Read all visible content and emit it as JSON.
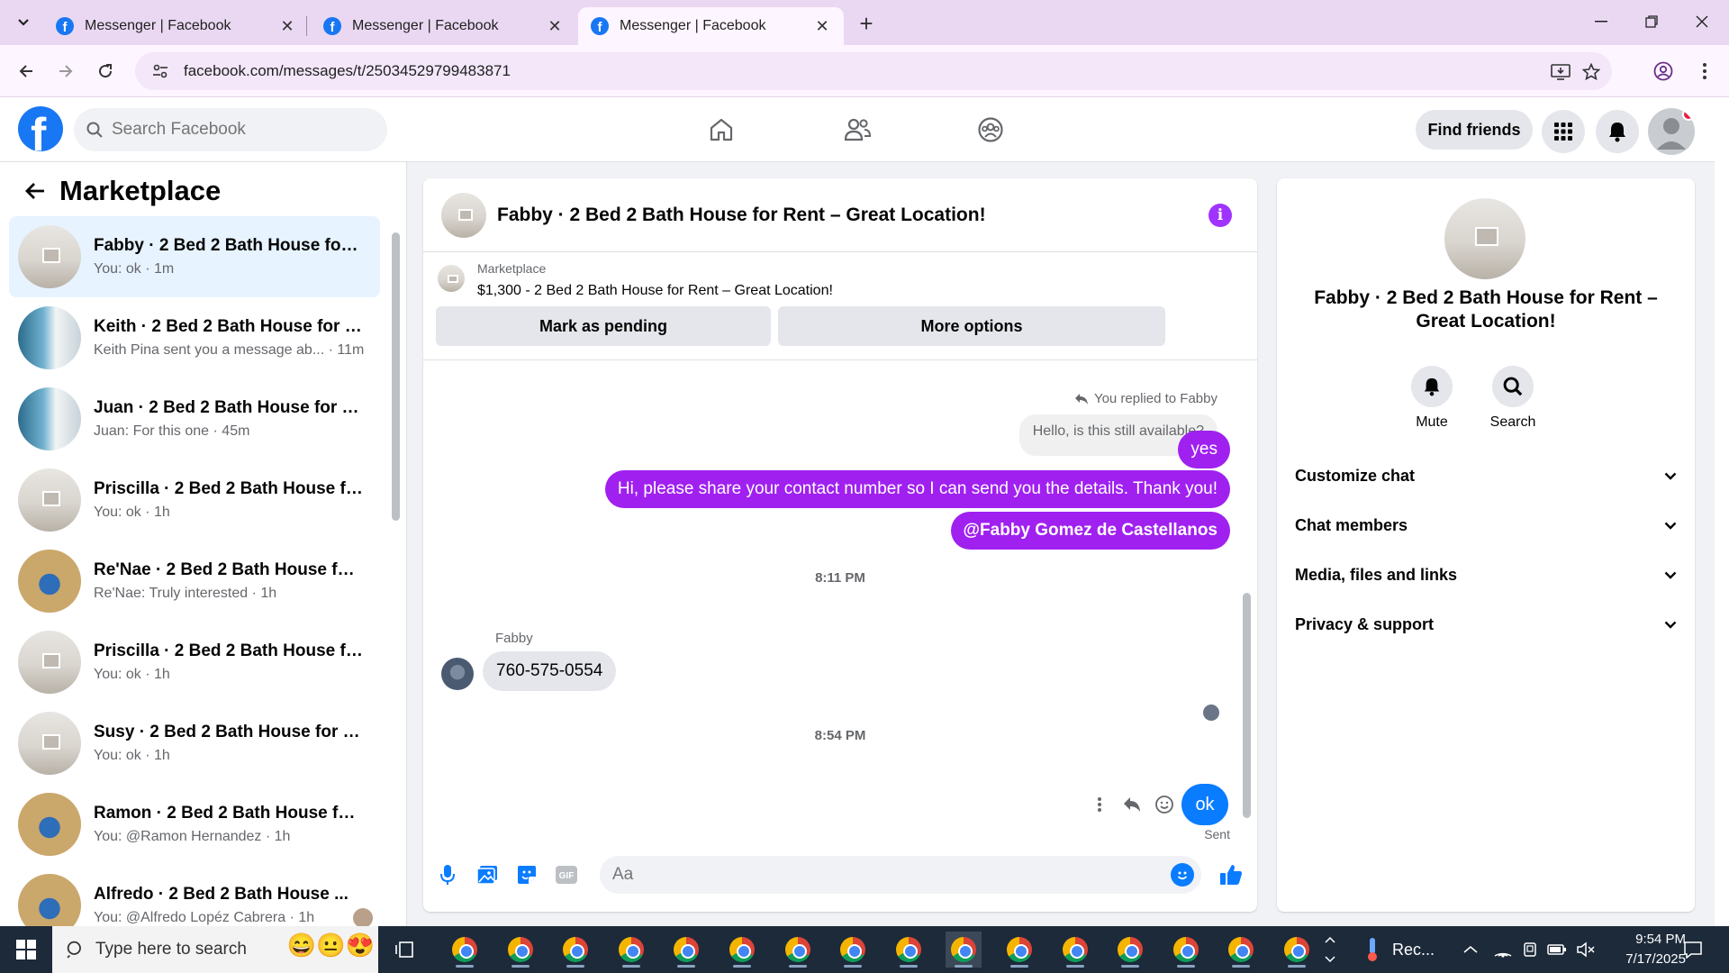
{
  "browser": {
    "tabs": [
      {
        "title": "Messenger | Facebook",
        "active": false
      },
      {
        "title": "Messenger | Facebook",
        "active": false
      },
      {
        "title": "Messenger | Facebook",
        "active": true
      }
    ],
    "url": "facebook.com/messages/t/25034529799483871"
  },
  "fb_header": {
    "search_placeholder": "Search Facebook",
    "find_friends_label": "Find friends"
  },
  "left_panel": {
    "title": "Marketplace",
    "conversations": [
      {
        "name": "Fabby · 2 Bed 2 Bath House for ...",
        "preview": "You: ok",
        "time": "1m",
        "avatar": "room",
        "selected": true
      },
      {
        "name": "Keith · 2 Bed 2 Bath House for R...",
        "preview": "Keith Pina sent you a message ab...",
        "time": "11m",
        "avatar": "blue"
      },
      {
        "name": "Juan · 2 Bed 2 Bath House for R...",
        "preview": "Juan: For this one",
        "time": "45m",
        "avatar": "blue"
      },
      {
        "name": "Priscilla · 2 Bed 2 Bath House for...",
        "preview": "You: ok",
        "time": "1h",
        "avatar": "room"
      },
      {
        "name": "Re'Nae · 2 Bed 2 Bath House for ...",
        "preview": "Re'Nae: Truly interested",
        "time": "1h",
        "avatar": "gold"
      },
      {
        "name": "Priscilla · 2 Bed 2 Bath House for...",
        "preview": "You: ok",
        "time": "1h",
        "avatar": "room"
      },
      {
        "name": "Susy · 2 Bed 2 Bath House for R...",
        "preview": "You: ok",
        "time": "1h",
        "avatar": "room"
      },
      {
        "name": "Ramon · 2 Bed 2 Bath House for...",
        "preview": "You: @Ramon Hernandez",
        "time": "1h",
        "avatar": "gold"
      },
      {
        "name": "Alfredo · 2 Bed 2 Bath House ...",
        "preview": "You: @Alfredo Lopéz Cabrera",
        "time": "1h",
        "avatar": "gold"
      }
    ]
  },
  "chat": {
    "title": "Fabby · 2 Bed 2 Bath House for Rent – Great Location!",
    "info_glyph": "i",
    "marketplace_label": "Marketplace",
    "listing": "$1,300 - 2 Bed 2 Bath House for Rent – Great Location!",
    "mark_pending_label": "Mark as pending",
    "more_options_label": "More options",
    "replied_label": "You replied to Fabby",
    "quoted_text": "Hello, is this still available?",
    "sent_messages": [
      "yes",
      "Hi, please share your contact number so I can send you the details. Thank you!",
      "@Fabby Gomez de Castellanos"
    ],
    "time_1": "8:11 PM",
    "sender_name": "Fabby",
    "incoming_message": "760-575-0554",
    "time_2": "8:54 PM",
    "last_message": "ok",
    "status": "Sent",
    "composer_placeholder": "Aa"
  },
  "right_panel": {
    "title": "Fabby · 2 Bed 2 Bath House for Rent – Great Location!",
    "mute_label": "Mute",
    "search_label": "Search",
    "sections": [
      "Customize chat",
      "Chat members",
      "Media, files and links",
      "Privacy & support"
    ]
  },
  "taskbar": {
    "search_placeholder": "Type here to search",
    "tray_label": "Rec...",
    "time": "9:54 PM",
    "date": "7/17/2025"
  },
  "colors": {
    "accent_purple": "#a020f0",
    "messenger_blue": "#0a7cff",
    "facebook_blue": "#1877f2"
  }
}
